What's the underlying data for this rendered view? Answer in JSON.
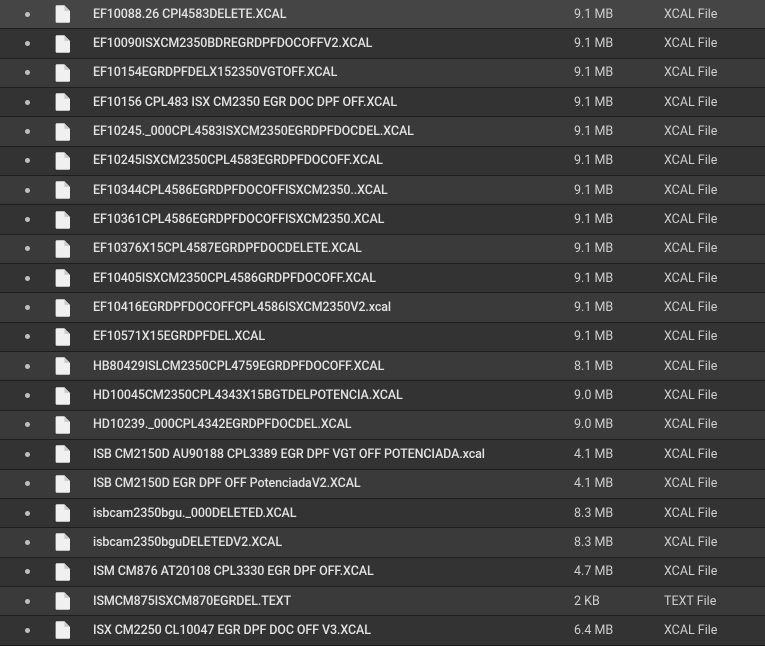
{
  "files": [
    {
      "name": "EF10088.26 CPl4583DELETE.XCAL",
      "size": "9.1 MB",
      "type": "XCAL File"
    },
    {
      "name": "EF10090ISXCM2350BDREGRDPFDOCOFFV2.XCAL",
      "size": "9.1 MB",
      "type": "XCAL File"
    },
    {
      "name": "EF10154EGRDPFDELX152350VGTOFF.XCAL",
      "size": "9.1 MB",
      "type": "XCAL File"
    },
    {
      "name": "EF10156 CPL483 ISX CM2350 EGR DOC DPF OFF.XCAL",
      "size": "9.1 MB",
      "type": "XCAL File"
    },
    {
      "name": "EF10245._000CPL4583ISXCM2350EGRDPFDOCDEL.XCAL",
      "size": "9.1 MB",
      "type": "XCAL File"
    },
    {
      "name": "EF10245ISXCM2350CPL4583EGRDPFDOCOFF.XCAL",
      "size": "9.1 MB",
      "type": "XCAL File"
    },
    {
      "name": "EF10344CPL4586EGRDPFDOCOFFISXCM2350..XCAL",
      "size": "9.1 MB",
      "type": "XCAL File"
    },
    {
      "name": "EF10361CPL4586EGRDPFDOCOFFISXCM2350.XCAL",
      "size": "9.1 MB",
      "type": "XCAL File"
    },
    {
      "name": "EF10376X15CPL4587EGRDPFDOCDELETE.XCAL",
      "size": "9.1 MB",
      "type": "XCAL File"
    },
    {
      "name": "EF10405ISXCM2350CPL4586GRDPFDOCOFF.XCAL",
      "size": "9.1 MB",
      "type": "XCAL File"
    },
    {
      "name": "EF10416EGRDPFDOCOFFCPL4586ISXCM2350V2.xcal",
      "size": "9.1 MB",
      "type": "XCAL File"
    },
    {
      "name": "EF10571X15EGRDPFDEL.XCAL",
      "size": "9.1 MB",
      "type": "XCAL File"
    },
    {
      "name": "HB80429ISLCM2350CPL4759EGRDPFDOCOFF.XCAL",
      "size": "8.1 MB",
      "type": "XCAL File"
    },
    {
      "name": "HD10045CM2350CPL4343X15BGTDELPOTENCIA.XCAL",
      "size": "9.0 MB",
      "type": "XCAL File"
    },
    {
      "name": "HD10239._000CPL4342EGRDPFDOCDEL.XCAL",
      "size": "9.0 MB",
      "type": "XCAL File"
    },
    {
      "name": "ISB CM2150D AU90188 CPL3389 EGR DPF VGT OFF POTENCIADA.xcal",
      "size": "4.1 MB",
      "type": "XCAL File"
    },
    {
      "name": "ISB CM2150D EGR DPF OFF PotenciadaV2.XCAL",
      "size": "4.1 MB",
      "type": "XCAL File"
    },
    {
      "name": "isbcam2350bgu._000DELETED.XCAL",
      "size": "8.3 MB",
      "type": "XCAL File"
    },
    {
      "name": "isbcam2350bguDELETEDV2.XCAL",
      "size": "8.3 MB",
      "type": "XCAL File"
    },
    {
      "name": "ISM CM876 AT20108 CPL3330 EGR DPF OFF.XCAL",
      "size": "4.7 MB",
      "type": "XCAL File"
    },
    {
      "name": "ISMCM875ISXCM870EGRDEL.TEXT",
      "size": "2 KB",
      "type": "TEXT File"
    },
    {
      "name": "ISX CM2250 CL10047 EGR DPF DOC OFF V3.XCAL",
      "size": "6.4 MB",
      "type": "XCAL File"
    }
  ]
}
